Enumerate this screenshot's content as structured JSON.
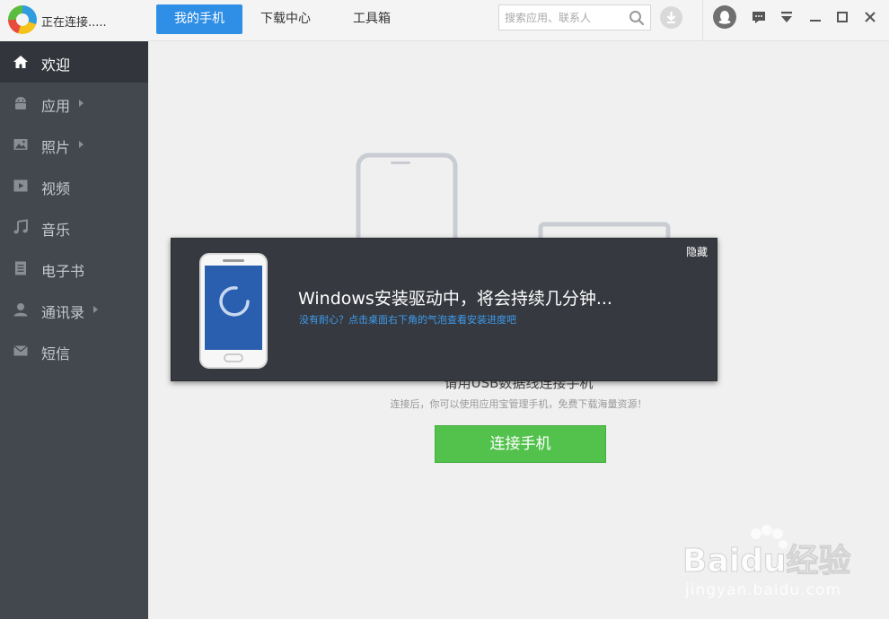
{
  "titlebar": {
    "status": "正在连接.....",
    "tabs": [
      {
        "label": "我的手机",
        "active": true
      },
      {
        "label": "下载中心",
        "active": false
      },
      {
        "label": "工具箱",
        "active": false
      }
    ],
    "search_placeholder": "搜索应用、联系人"
  },
  "sidebar": {
    "items": [
      {
        "label": "欢迎",
        "icon": "home-icon",
        "active": true,
        "arrow": false
      },
      {
        "label": "应用",
        "icon": "android-icon",
        "active": false,
        "arrow": true
      },
      {
        "label": "照片",
        "icon": "image-icon",
        "active": false,
        "arrow": true
      },
      {
        "label": "视频",
        "icon": "video-icon",
        "active": false,
        "arrow": false
      },
      {
        "label": "音乐",
        "icon": "music-icon",
        "active": false,
        "arrow": false
      },
      {
        "label": "电子书",
        "icon": "ebook-icon",
        "active": false,
        "arrow": false
      },
      {
        "label": "通讯录",
        "icon": "contact-icon",
        "active": false,
        "arrow": true
      },
      {
        "label": "短信",
        "icon": "mail-icon",
        "active": false,
        "arrow": false
      }
    ]
  },
  "main": {
    "usb_prompt": "请用USB数据线连接手机",
    "sub_prompt": "连接后，你可以使用应用宝管理手机，免费下载海量资源！",
    "connect_button": "连接手机"
  },
  "dialog": {
    "hide_label": "隐藏",
    "title": "Windows安装驱动中，将会持续几分钟...",
    "hint": "没有耐心？点击桌面右下角的气泡查看安装进度吧"
  },
  "watermark": {
    "brand": "Baidu经验",
    "url": "jingyan.baidu.com"
  },
  "colors": {
    "accent": "#2f8ee6",
    "sidebar": "#43484f",
    "sidebar_active": "#32363c",
    "button_green": "#52c24d",
    "dialog_bg": "#36393f",
    "link_blue": "#3d9cf0"
  }
}
